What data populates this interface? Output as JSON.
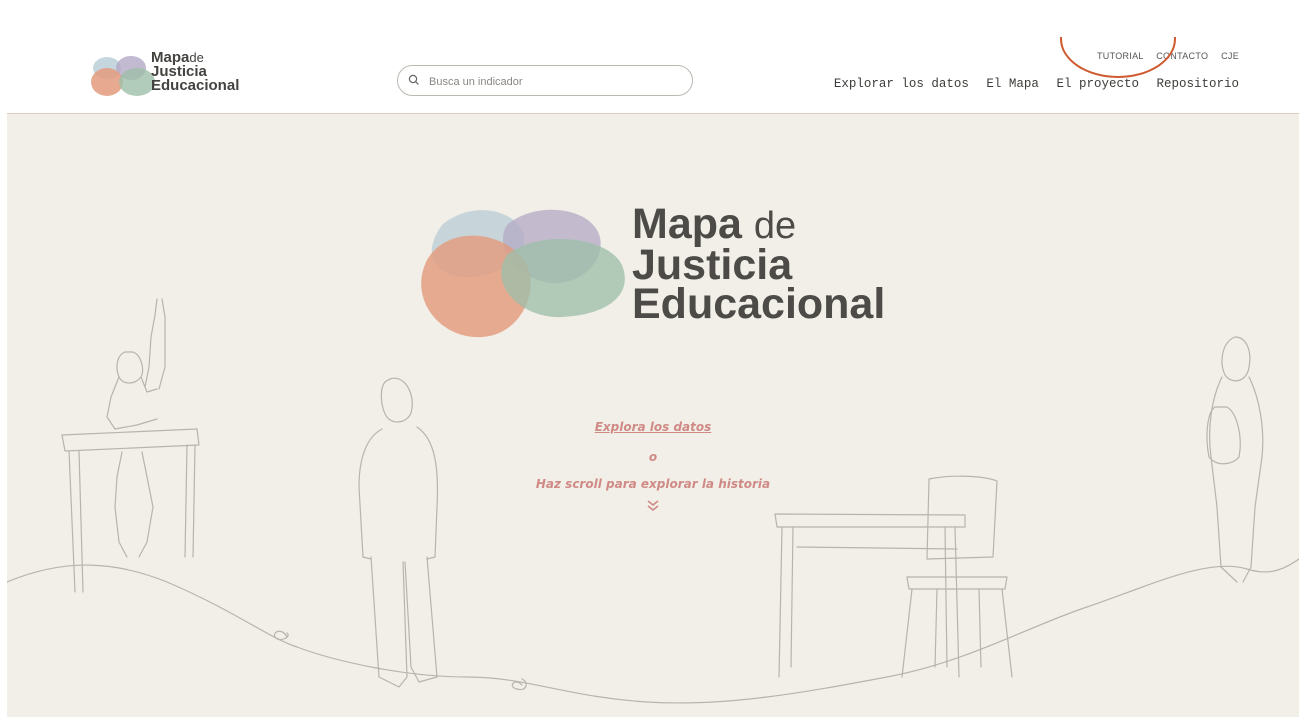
{
  "header": {
    "logo": {
      "line1": "Mapa",
      "line1b": "de",
      "line2": "Justicia",
      "line3": "Educacional"
    },
    "search": {
      "placeholder": "Busca un indicador",
      "value": ""
    },
    "top_links": [
      "TUTORIAL",
      "CONTACTO",
      "CJE"
    ],
    "main_nav": [
      "Explorar los datos",
      "El Mapa",
      "El proyecto",
      "Repositorio"
    ]
  },
  "hero": {
    "title_line1": "Mapa",
    "title_line1b": "de",
    "title_line2": "Justicia",
    "title_line3": "Educacional",
    "cta_explore": "Explora los datos",
    "cta_or": "o",
    "cta_scroll": "Haz scroll para explorar la historia",
    "scroll_icon": "double-chevron-down-icon"
  },
  "colors": {
    "background": "#f1efe7",
    "accent_pink": "#d08a86",
    "highlight_ring": "#cf5a2f",
    "blob_orange": "#e39b7e",
    "blob_blue": "#b8ccd6",
    "blob_purple": "#b3a9c4",
    "blob_green": "#9ebfa9"
  }
}
